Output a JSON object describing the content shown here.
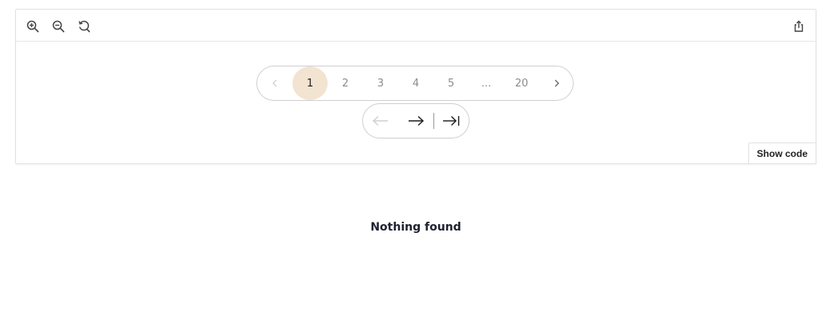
{
  "toolbar": {
    "zoom_in_icon": "zoom-in-icon",
    "zoom_out_icon": "zoom-out-icon",
    "reset_icon": "reset-icon",
    "share_icon": "share-icon"
  },
  "pagination": {
    "prev_icon": "chevron-left-icon",
    "next_icon": "chevron-right-icon",
    "pages": [
      "1",
      "2",
      "3",
      "4",
      "5",
      "...",
      "20"
    ],
    "active_page": "1",
    "active_color": "#f3e3d1"
  },
  "nav": {
    "back_icon": "arrow-left-icon",
    "forward_icon": "arrow-right-icon",
    "last_icon": "arrow-to-end-icon"
  },
  "show_code_label": "Show code",
  "empty_message": "Nothing found"
}
